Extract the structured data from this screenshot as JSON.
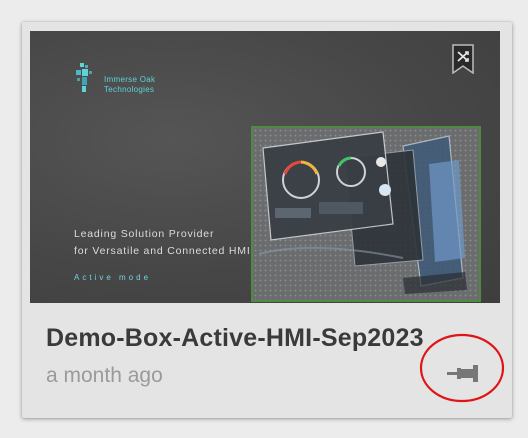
{
  "card": {
    "title": "Demo-Box-Active-HMI-Sep2023",
    "timestamp": "a month ago",
    "pin_icon": "pin-icon",
    "badge_icon": "shuffle-bookmark-icon"
  },
  "thumbnail": {
    "company_name_line1": "Immerse Oak",
    "company_name_line2": "Technologies",
    "tagline_line1": "Leading Solution Provider",
    "tagline_line2": "for Versatile and Connected HMIs.",
    "mode_text": "Active mode"
  },
  "colors": {
    "accent_teal": "#5fd3d8",
    "annotation_red": "#e01414",
    "hmi_border": "#4e8a40"
  }
}
